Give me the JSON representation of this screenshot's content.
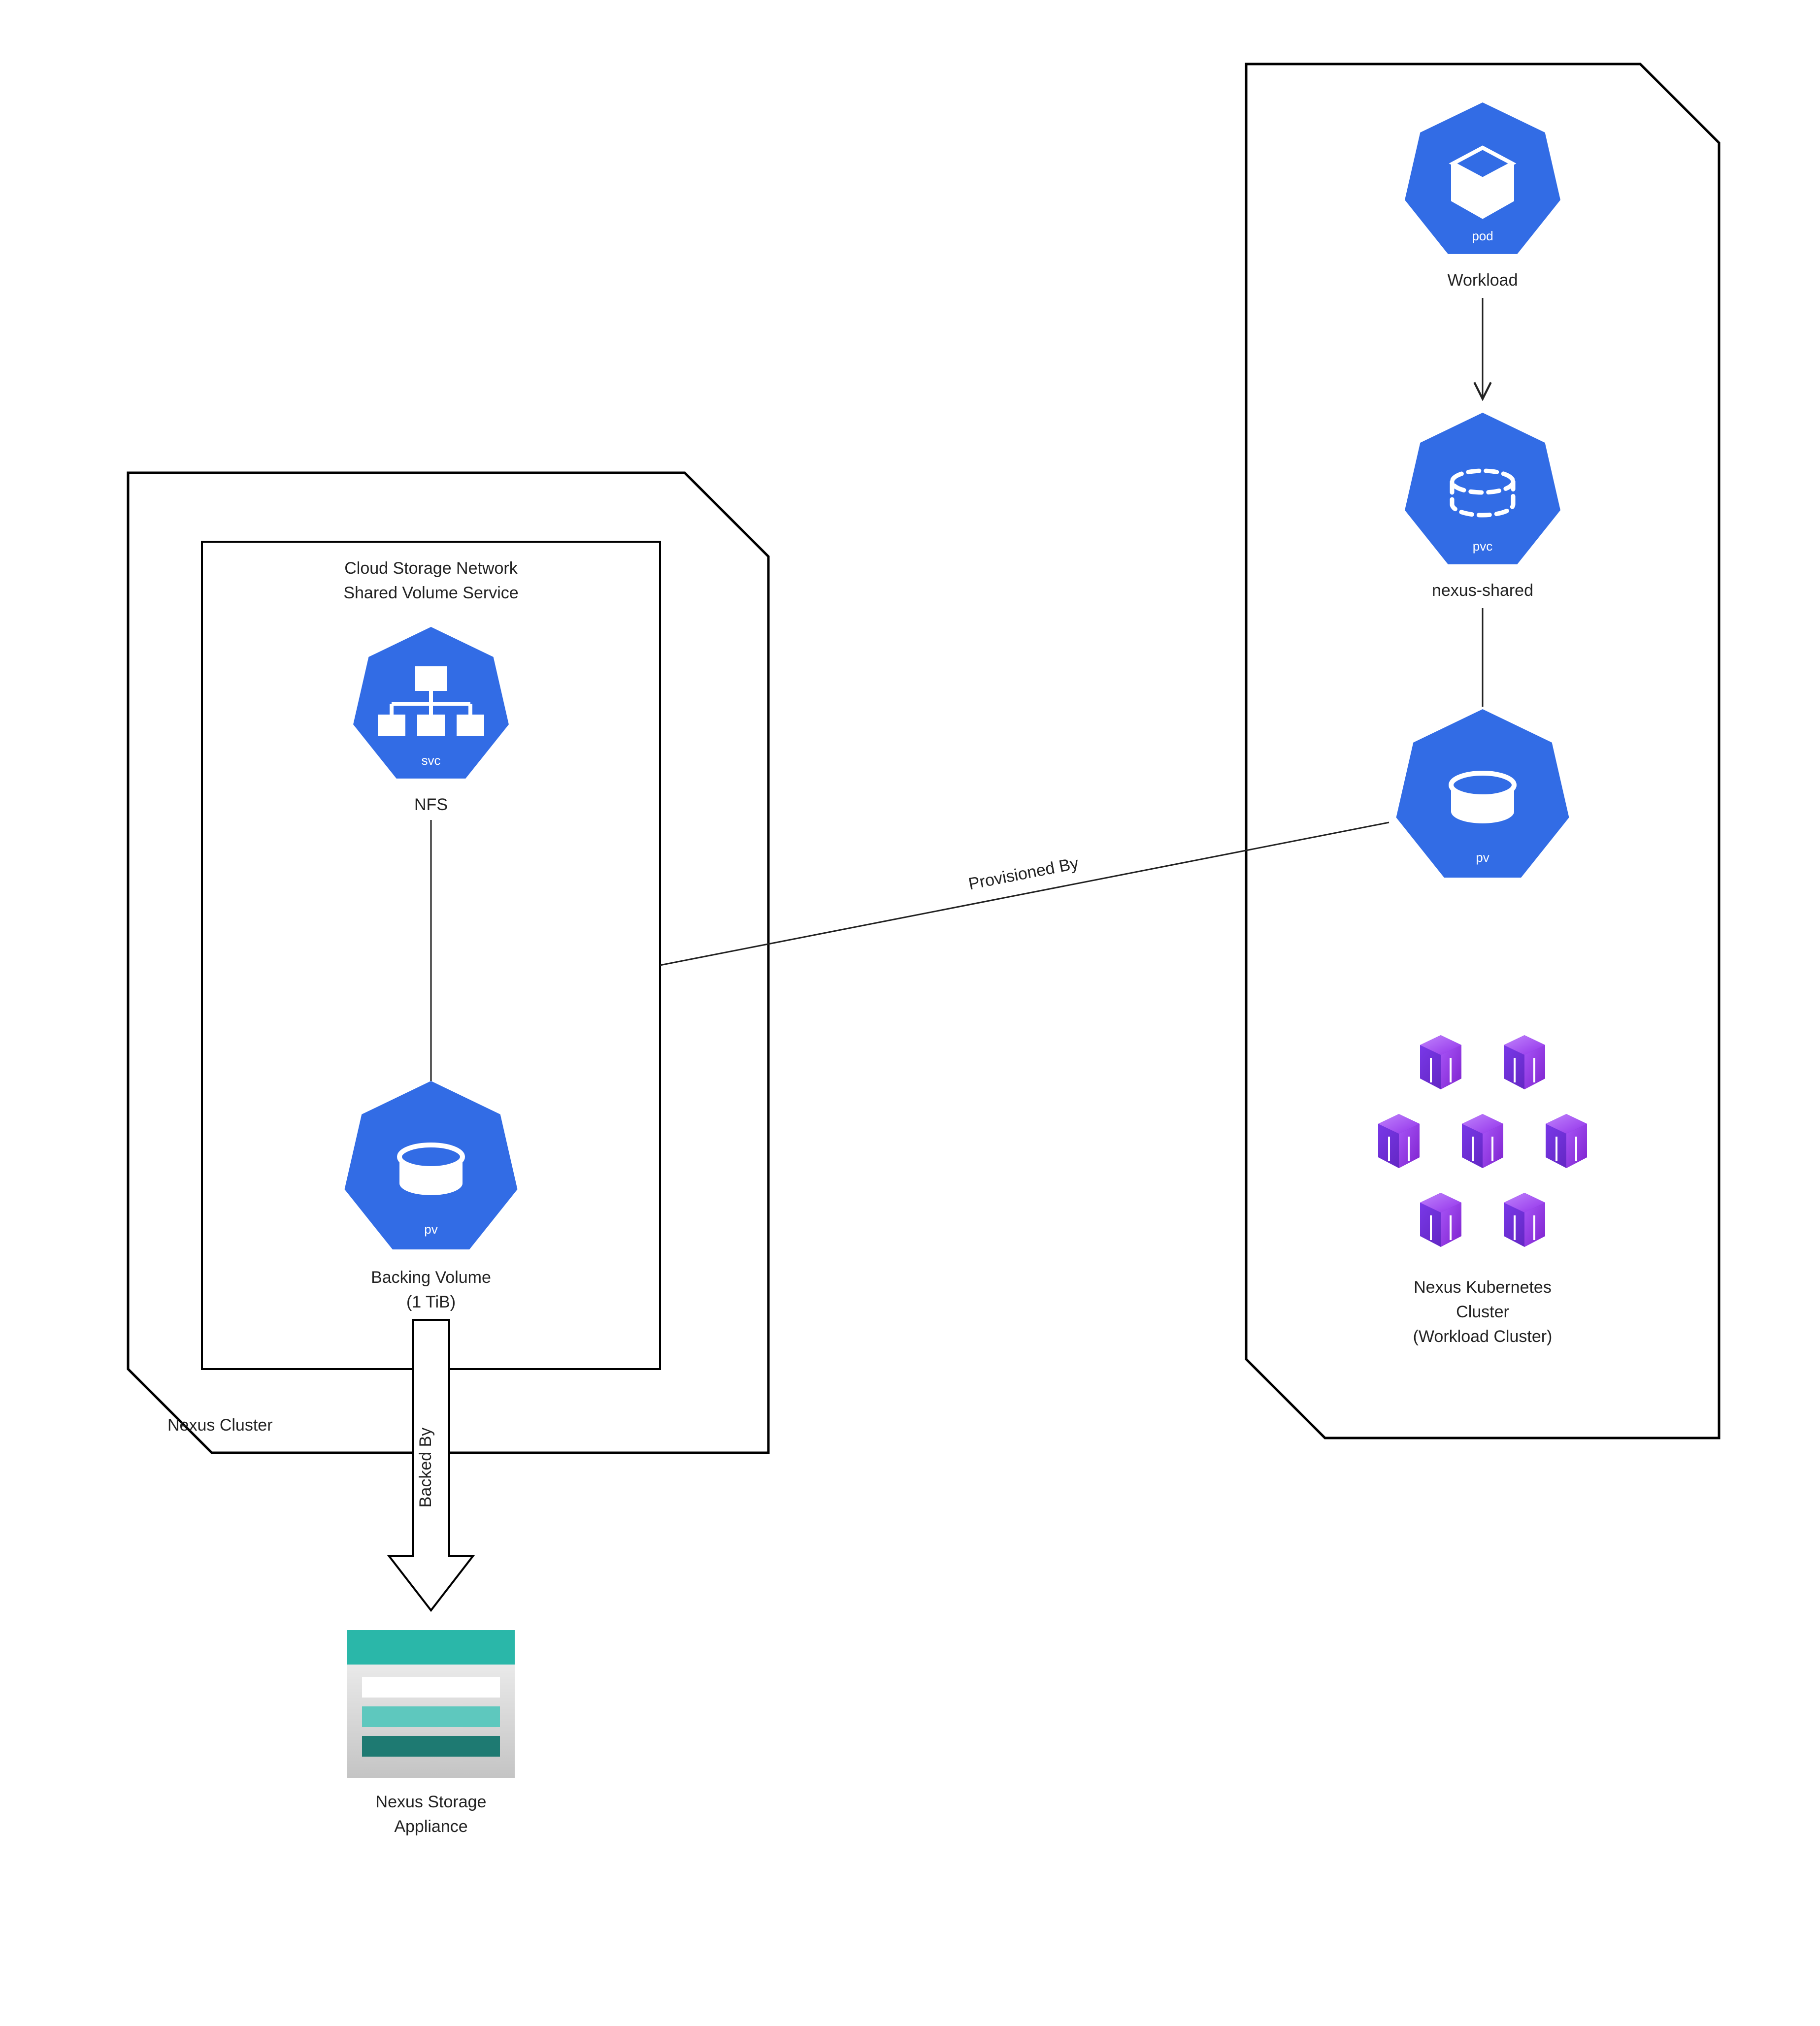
{
  "diagram": {
    "left_cluster": {
      "title": "Nexus Cluster",
      "service_box": {
        "title_l1": "Cloud Storage Network",
        "title_l2": "Shared Volume Service",
        "svc": {
          "badge": "svc",
          "label": "NFS"
        },
        "pv": {
          "badge": "pv",
          "label_l1": "Backing Volume",
          "label_l2": "(1 TiB)"
        }
      }
    },
    "right_cluster": {
      "pod": {
        "badge": "pod",
        "label": "Workload"
      },
      "pvc": {
        "badge": "pvc",
        "label": "nexus-shared"
      },
      "pv": {
        "badge": "pv"
      },
      "footer_l1": "Nexus Kubernetes",
      "footer_l2": "Cluster",
      "footer_l3": "(Workload Cluster)"
    },
    "storage": {
      "label_l1": "Nexus Storage",
      "label_l2": "Appliance"
    },
    "edges": {
      "provisioned_by": "Provisioned By",
      "backed_by": "Backed By"
    },
    "colors": {
      "k8s_blue": "#326ce5",
      "node_purple": "#8b5cf6",
      "node_purple_dark": "#6d28d9",
      "storage_top": "#2ab7a9",
      "storage_mid": "#5ec8be",
      "storage_dark": "#1e7a72",
      "storage_bg1": "#f0f0f0",
      "storage_bg2": "#c8c8c8"
    }
  }
}
